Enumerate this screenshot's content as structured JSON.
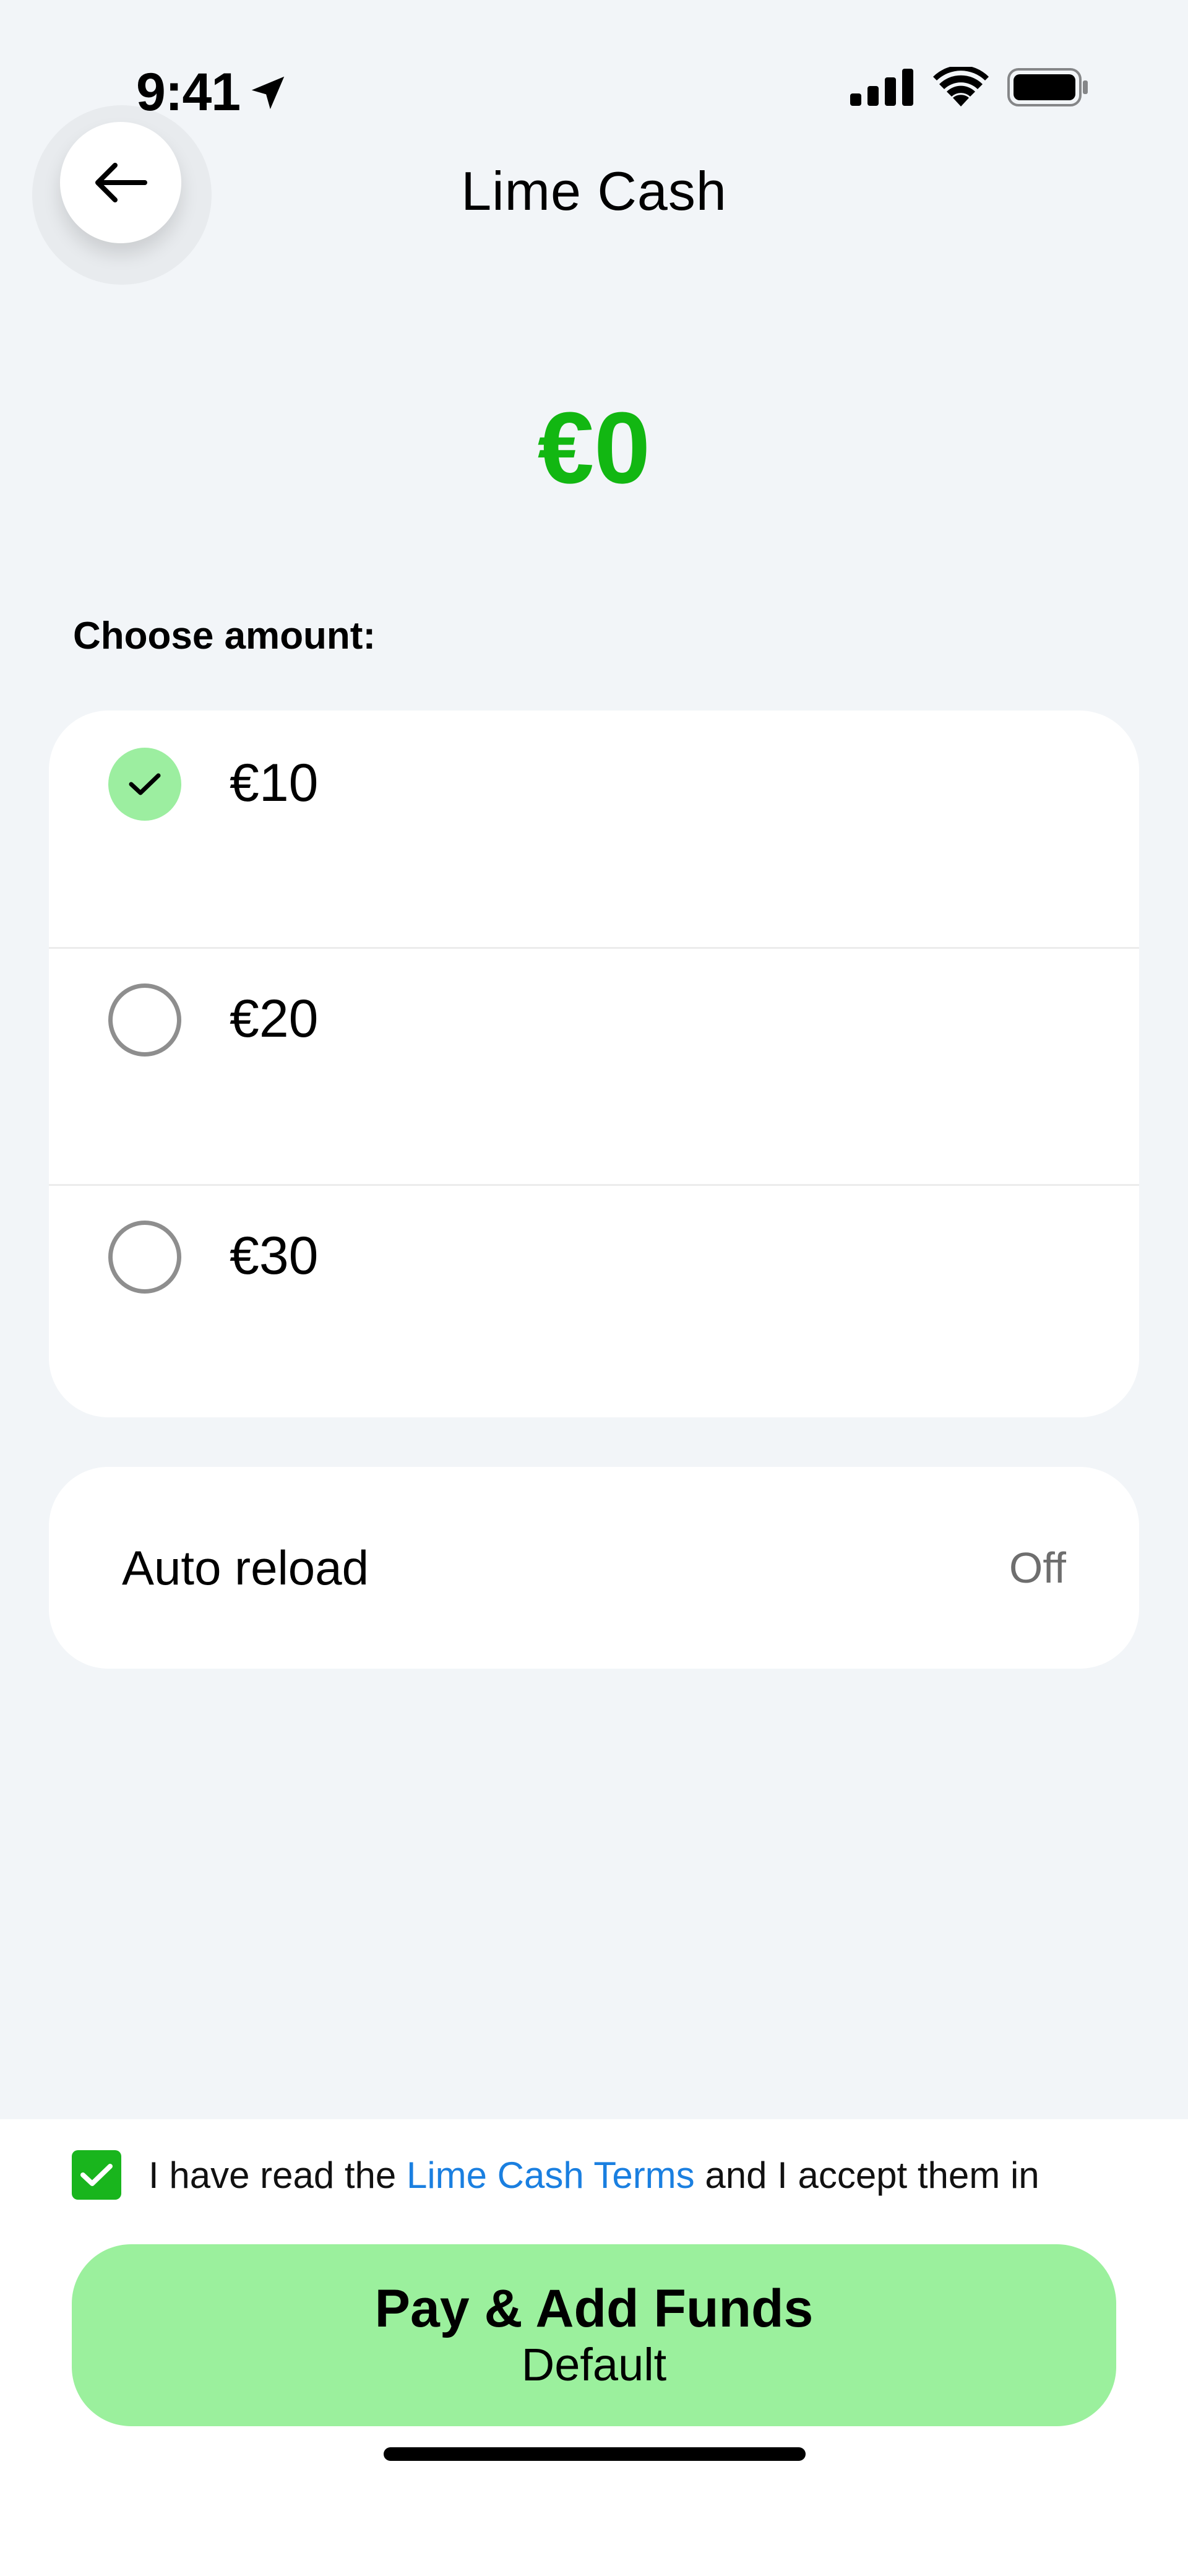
{
  "status_bar": {
    "time": "9:41",
    "icons": [
      "location-arrow-icon",
      "cellular-signal-icon",
      "wifi-icon",
      "battery-icon"
    ]
  },
  "header": {
    "back_icon": "arrow-left-icon",
    "title": "Lime Cash"
  },
  "balance": "€0",
  "amount_section": {
    "label": "Choose amount:",
    "options": [
      {
        "label": "€10",
        "selected": true
      },
      {
        "label": "€20",
        "selected": false
      },
      {
        "label": "€30",
        "selected": false
      }
    ]
  },
  "auto_reload": {
    "label": "Auto reload",
    "value": "Off"
  },
  "terms": {
    "checked": true,
    "prefix": "I have read the ",
    "link": "Lime Cash Terms",
    "suffix": " and I accept them in"
  },
  "pay_button": {
    "label": "Pay & Add Funds",
    "sublabel": "Default"
  },
  "colors": {
    "background": "#f2f5f8",
    "balance_green": "#12b712",
    "selected_radio": "#9ceea0",
    "checkbox_green": "#19b51d",
    "link_blue": "#1a7fe0",
    "pay_button": "#9bf09d"
  }
}
